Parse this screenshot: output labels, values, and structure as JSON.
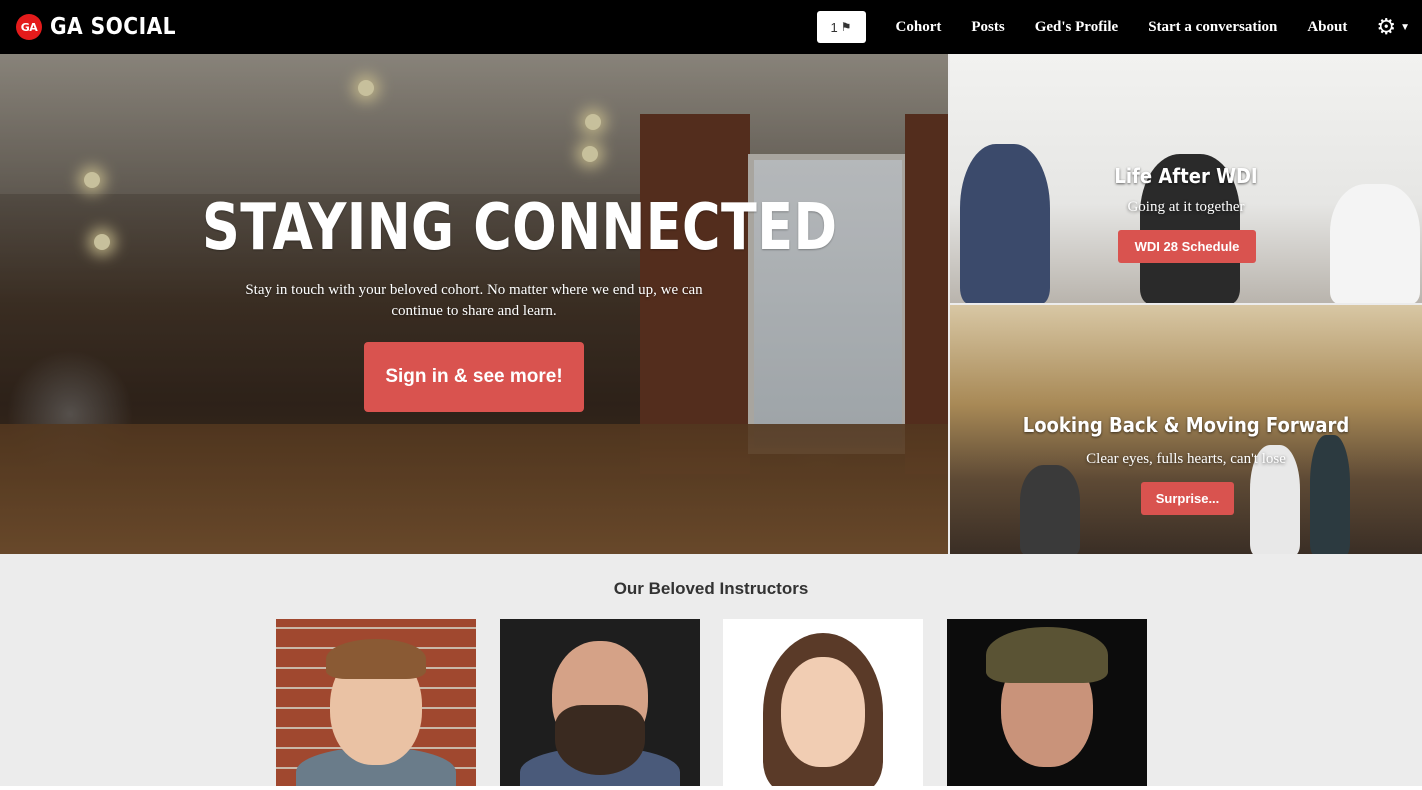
{
  "nav": {
    "logo_text": "GA",
    "brand": "GA SOCIAL",
    "flag_count": "1",
    "flag_icon": "flag-icon",
    "links": [
      "Cohort",
      "Posts",
      "Ged's Profile",
      "Start a conversation",
      "About"
    ],
    "settings_icon": "gear-icon"
  },
  "hero": {
    "title": "STAYING CONNECTED",
    "subtitle": "Stay in touch with your beloved cohort. No matter where we end up, we can continue to share and learn.",
    "button": "Sign in & see more!"
  },
  "panels": [
    {
      "title": "Life After WDI",
      "subtitle": "Going at it together",
      "button": "WDI 28 Schedule"
    },
    {
      "title": "Looking Back & Moving Forward",
      "subtitle": "Clear eyes, fulls hearts, can't lose",
      "button": "Surprise..."
    }
  ],
  "instructors": {
    "heading": "Our Beloved Instructors"
  },
  "colors": {
    "accent": "#d9534f",
    "brand_red": "#e41b1b",
    "navbar": "#000000",
    "page_bg": "#ececec"
  }
}
